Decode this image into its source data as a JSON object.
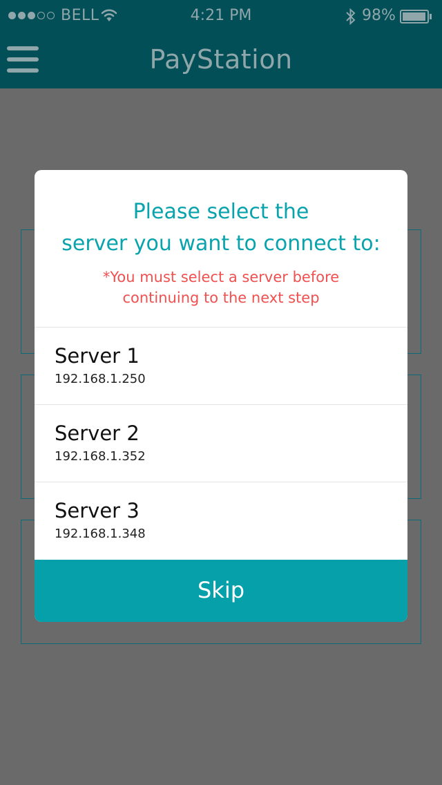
{
  "status_bar": {
    "carrier": "BELL",
    "time": "4:21 PM",
    "battery_text": "98%",
    "battery_level": 0.98,
    "signal_bars_filled": 3,
    "signal_bars_total": 5,
    "wifi_icon": "wifi-icon",
    "bluetooth_icon": "bluetooth-icon"
  },
  "nav": {
    "title": "PayStation",
    "menu_icon": "hamburger-menu-icon"
  },
  "modal": {
    "title_line1": "Please select the",
    "title_line2": "server you want to connect to:",
    "warning_line1": "*You must select a server before",
    "warning_line2": "continuing to the next step",
    "servers": [
      {
        "name": "Server 1",
        "ip": "192.168.1.250"
      },
      {
        "name": "Server 2",
        "ip": "192.168.1.352"
      },
      {
        "name": "Server 3",
        "ip": "192.168.1.348"
      }
    ],
    "skip_label": "Skip"
  },
  "colors": {
    "header_bg": "#034f58",
    "header_text": "#8fa7aa",
    "overlay_bg": "#6a6a6a",
    "accent": "#05a0aa",
    "warning": "#ef5050"
  }
}
